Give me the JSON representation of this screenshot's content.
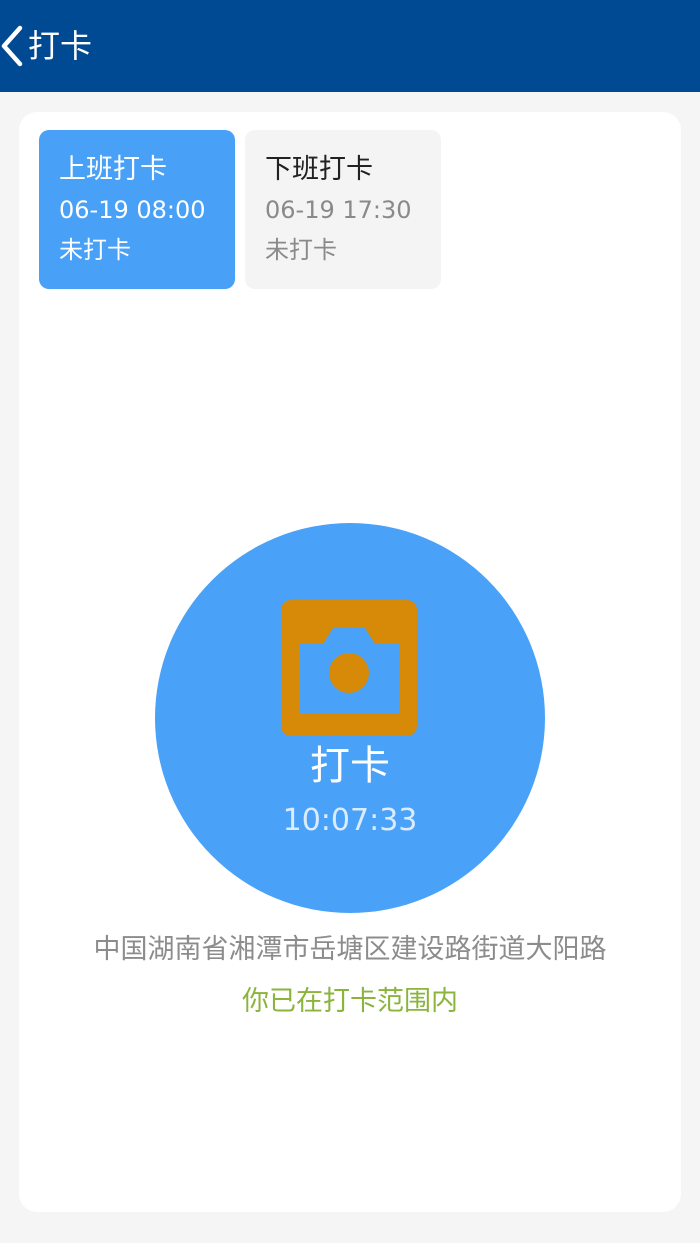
{
  "header": {
    "title": "打卡",
    "background": "#004a94",
    "back_icon": "chevron-left-icon"
  },
  "shifts": [
    {
      "label": "上班打卡",
      "time": "06-19 08:00",
      "status": "未打卡",
      "selected": true,
      "color": "#48a0f7"
    },
    {
      "label": "下班打卡",
      "time": "06-19 17:30",
      "status": "未打卡",
      "selected": false,
      "color": "#f4f4f4"
    }
  ],
  "punch": {
    "label": "打卡",
    "time": "10:07:33",
    "icon": "camera-icon",
    "color": "#4aa2f8",
    "icon_color": "#d68a07"
  },
  "location": {
    "address": "中国湖南省湘潭市岳塘区建设路街道大阳路",
    "status": "你已在打卡范围内",
    "status_color": "#8ab43c"
  }
}
